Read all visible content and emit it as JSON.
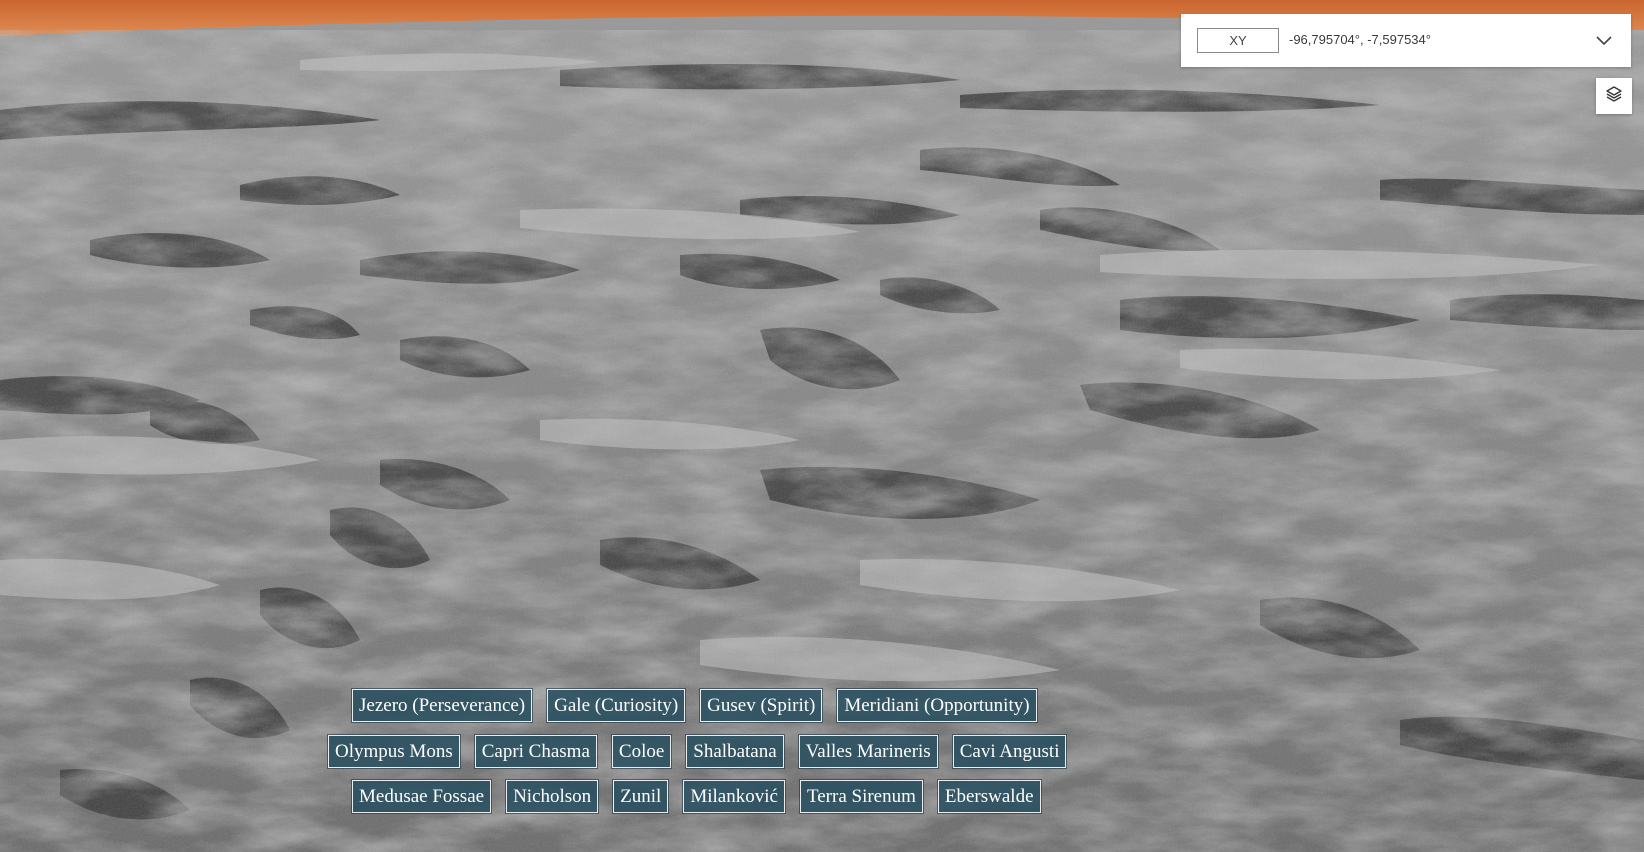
{
  "coordinates": {
    "format": "XY",
    "value": "-96,795704°, -7,597534°",
    "expand_icon": "chevron-down-icon"
  },
  "layers": {
    "icon": "layers-icon"
  },
  "sky_color": "#d2733d",
  "bookmark_color": "#284e60",
  "bookmarks": {
    "row1": [
      "Jezero (Perseverance)",
      "Gale (Curiosity)",
      "Gusev (Spirit)",
      "Meridiani (Opportunity)"
    ],
    "row2": [
      "Olympus Mons",
      "Capri Chasma",
      "Coloe",
      "Shalbatana",
      "Valles Marineris",
      "Cavi Angusti"
    ],
    "row3": [
      "Medusae Fossae",
      "Nicholson",
      "Zunil",
      "Milanković",
      "Terra Sirenum",
      "Eberswalde"
    ]
  }
}
